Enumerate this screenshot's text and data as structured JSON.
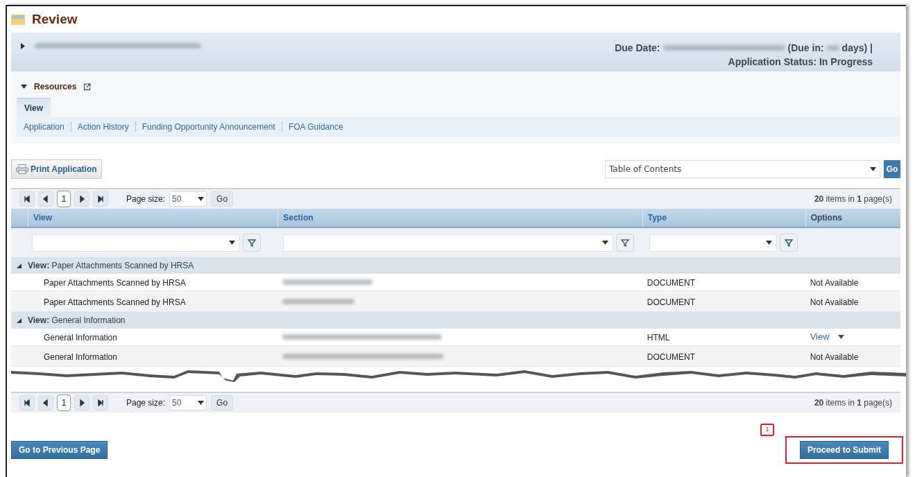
{
  "page_title": "Review",
  "header": {
    "expanded": false,
    "due_date_label": "Due Date:",
    "due_in_label": "(Due in:",
    "due_in_suffix": "days) |",
    "status": "Application Status: In Progress"
  },
  "resources": {
    "title": "Resources",
    "expanded": true,
    "tabs": [
      {
        "label": "View",
        "selected": true
      }
    ],
    "links": [
      "Application",
      "Action History",
      "Funding Opportunity Announcement",
      "FOA Guidance"
    ]
  },
  "print_button": "Print Application",
  "jump": {
    "value": "Table of Contents",
    "go": "Go"
  },
  "pagers": [
    {
      "page": "1",
      "page_size_label": "Page size:",
      "page_size": "50",
      "go": "Go",
      "count": "**20** items in **1** page(s)"
    },
    {
      "page": "1",
      "page_size_label": "Page size:",
      "page_size": "50",
      "go": "Go",
      "count": "**20** items in **1** page(s)"
    }
  ],
  "table": {
    "columns": [
      {
        "label": "View",
        "sortable": true
      },
      {
        "label": "Section",
        "sortable": true
      },
      {
        "label": "Type",
        "sortable": true
      },
      {
        "label": "Options",
        "sortable": false
      }
    ],
    "groups": [
      {
        "label": "View:",
        "name": "Paper Attachments Scanned by HRSA",
        "expanded": true,
        "rows": [
          {
            "view": "Paper Attachments Scanned by HRSA",
            "type": "DOCUMENT",
            "options": {
              "kind": "text",
              "label": "Not Available"
            }
          },
          {
            "view": "Paper Attachments Scanned by HRSA",
            "type": "DOCUMENT",
            "options": {
              "kind": "text",
              "label": "Not Available"
            }
          }
        ]
      },
      {
        "label": "View:",
        "name": "General Information",
        "expanded": true,
        "rows": [
          {
            "view": "General Information",
            "type": "HTML",
            "options": {
              "kind": "menu",
              "label": "View"
            }
          },
          {
            "view": "General Information",
            "type": "DOCUMENT",
            "options": {
              "kind": "text",
              "label": "Not Available"
            }
          }
        ]
      }
    ]
  },
  "buttons": {
    "previous": "Go to Previous Page",
    "submit": "Proceed to Submit"
  },
  "callout": "1"
}
